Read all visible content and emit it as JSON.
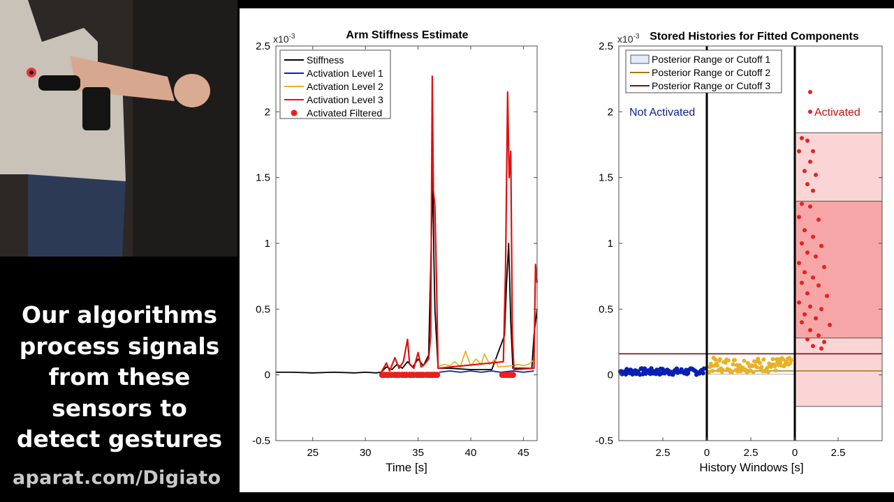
{
  "caption": "Our algorithms\nprocess signals\nfrom  these\nsensors to\ndetect gestures",
  "watermark": "aparat.com/Digiato",
  "photo": {
    "description_icon": "person-with-armband-sensors-photo"
  },
  "colors": {
    "stiffness": "#000000",
    "level1": "#0a1fb5",
    "level2": "#e8b227",
    "level3": "#e01010",
    "activated_points": "#ea1f1f",
    "not_activated_text": "#0a1f8f",
    "activated_text": "#c01010",
    "cutoff2": "#9b7a12",
    "cutoff3": "#7a0d0d"
  },
  "chart_data": [
    {
      "type": "line",
      "title": "Arm Stiffness Estimate",
      "xlabel": "Time [s]",
      "ylabel": "",
      "exponent_label": "x10-3",
      "xlim": [
        21.5,
        46.3
      ],
      "ylim": [
        -0.5,
        2.5
      ],
      "xticks": [
        25,
        30,
        35,
        40,
        45
      ],
      "yticks": [
        -0.5,
        0,
        0.5,
        1,
        1.5,
        2,
        2.5
      ],
      "ytick_labels": [
        "-0.5",
        "0",
        "0.5",
        "1",
        "1.5",
        "2",
        "2.5"
      ],
      "grid": false,
      "legend_position": "top-left",
      "legend": [
        "Stiffness",
        "Activation Level 1",
        "Activation Level 2",
        "Activation Level 3",
        "Activated Filtered"
      ],
      "series": [
        {
          "name": "Stiffness",
          "color": "#000000",
          "points": [
            [
              21.5,
              0.02
            ],
            [
              23,
              0.02
            ],
            [
              25,
              0.015
            ],
            [
              27,
              0.02
            ],
            [
              29,
              0.015
            ],
            [
              30,
              0.02
            ],
            [
              31,
              0.015
            ],
            [
              31.5,
              0.02
            ],
            [
              32,
              0.06
            ],
            [
              32.5,
              0.04
            ],
            [
              33,
              0.08
            ],
            [
              33.5,
              0.05
            ],
            [
              34,
              0.1
            ],
            [
              34.5,
              0.06
            ],
            [
              35,
              0.12
            ],
            [
              35.5,
              0.07
            ],
            [
              36,
              0.15
            ],
            [
              36.4,
              1.5
            ],
            [
              36.5,
              0.9
            ],
            [
              36.6,
              0.5
            ],
            [
              36.9,
              0.05
            ],
            [
              38,
              0.05
            ],
            [
              40,
              0.04
            ],
            [
              42,
              0.04
            ],
            [
              43.2,
              0.3
            ],
            [
              43.4,
              0.7
            ],
            [
              43.6,
              1.0
            ],
            [
              43.8,
              0.4
            ],
            [
              44,
              0.05
            ],
            [
              45,
              0.05
            ],
            [
              45.8,
              0.05
            ],
            [
              46,
              0.3
            ],
            [
              46.3,
              0.5
            ]
          ]
        },
        {
          "name": "Activation Level 1",
          "color": "#0a1fb5",
          "points": [
            [
              37,
              0.02
            ],
            [
              38,
              0.03
            ],
            [
              39,
              0.02
            ],
            [
              40,
              0.03
            ],
            [
              41,
              0.02
            ],
            [
              42,
              0.03
            ],
            [
              42.8,
              0.02
            ],
            [
              44,
              0.03
            ],
            [
              45,
              0.02
            ],
            [
              46,
              0.03
            ]
          ]
        },
        {
          "name": "Activation Level 2",
          "color": "#e8b227",
          "points": [
            [
              36.8,
              0.06
            ],
            [
              37.5,
              0.08
            ],
            [
              38,
              0.07
            ],
            [
              38.5,
              0.1
            ],
            [
              39,
              0.06
            ],
            [
              39.5,
              0.18
            ],
            [
              40,
              0.07
            ],
            [
              40.5,
              0.12
            ],
            [
              41,
              0.08
            ],
            [
              41.3,
              0.16
            ],
            [
              41.8,
              0.08
            ],
            [
              42.3,
              0.12
            ],
            [
              42.6,
              0.06
            ],
            [
              44,
              0.07
            ],
            [
              44.5,
              0.08
            ],
            [
              45,
              0.07
            ],
            [
              45.5,
              0.08
            ],
            [
              46.1,
              0.12
            ]
          ]
        },
        {
          "name": "Activation Level 3",
          "color": "#e01010",
          "points": [
            [
              31.5,
              0.02
            ],
            [
              32,
              0.09
            ],
            [
              32.3,
              0.03
            ],
            [
              32.8,
              0.13
            ],
            [
              33.2,
              0.05
            ],
            [
              33.6,
              0.1
            ],
            [
              34,
              0.27
            ],
            [
              34.2,
              0.08
            ],
            [
              34.6,
              0.05
            ],
            [
              35,
              0.17
            ],
            [
              35.3,
              0.06
            ],
            [
              35.6,
              0.08
            ],
            [
              36,
              0.12
            ],
            [
              36.2,
              0.3
            ],
            [
              36.35,
              2.27
            ],
            [
              36.45,
              1.4
            ],
            [
              36.6,
              1.28
            ],
            [
              36.75,
              0.7
            ],
            [
              36.9,
              0.05
            ],
            [
              43.1,
              0.1
            ],
            [
              43.3,
              0.8
            ],
            [
              43.5,
              2.15
            ],
            [
              43.65,
              1.5
            ],
            [
              43.8,
              1.7
            ],
            [
              43.95,
              0.3
            ],
            [
              44.1,
              0.04
            ],
            [
              46,
              0.05
            ],
            [
              46.15,
              0.84
            ],
            [
              46.3,
              0.7
            ]
          ]
        }
      ],
      "activated_filtered_x": [
        31.6,
        31.8,
        32.0,
        32.2,
        32.5,
        32.8,
        33.0,
        33.2,
        33.5,
        33.7,
        33.9,
        34.2,
        34.4,
        34.6,
        34.9,
        35.1,
        35.3,
        35.5,
        35.8,
        36.0,
        36.2,
        36.4,
        36.6,
        36.8,
        43.0,
        43.2,
        43.4,
        43.6,
        43.8,
        44.0
      ],
      "activated_filtered_y": 0
    },
    {
      "type": "scatter",
      "title": "Stored Histories for Fitted Components",
      "xlabel": "History Windows [s]",
      "exponent_label": "x10-3",
      "ylim": [
        -0.5,
        2.5
      ],
      "yticks": [
        -0.5,
        0,
        0.5,
        1,
        1.5,
        2,
        2.5
      ],
      "ytick_labels": [
        "-0.5",
        "0",
        "0.5",
        "1",
        "1.5",
        "2",
        "2.5"
      ],
      "xtick_labels": [
        "2.5",
        "0",
        "2.5",
        "0",
        "2.5"
      ],
      "grid": false,
      "legend_position": "top-left",
      "legend": [
        "Posterior Range or Cutoff 1",
        "Posterior Range or Cutoff 2",
        "Posterior Range or Cutoff 3"
      ],
      "annotations": [
        "Not Activated",
        "Activated"
      ],
      "cutoff_lines": [
        {
          "name": "Posterior Range or Cutoff 3",
          "y": 0.16
        },
        {
          "name": "Posterior Range or Cutoff 2",
          "y": 0.03
        }
      ],
      "bands": [
        {
          "y0": -0.24,
          "y1": 1.84,
          "shade": "light"
        },
        {
          "y0": 0.28,
          "y1": 1.32,
          "shade": "medium"
        }
      ],
      "groups": [
        {
          "name": "Not Activated",
          "color": "#0a1fb5",
          "y_range": [
            0.0,
            0.05
          ]
        },
        {
          "name": "Level 2",
          "color": "#e8b227",
          "y_range": [
            0.02,
            0.13
          ]
        },
        {
          "name": "Activated",
          "color": "#ea1f1f",
          "points": [
            [
              0.2,
              1.8
            ],
            [
              0.4,
              1.78
            ],
            [
              0.1,
              1.7
            ],
            [
              0.6,
              1.7
            ],
            [
              0.5,
              1.62
            ],
            [
              0.3,
              1.55
            ],
            [
              0.7,
              1.52
            ],
            [
              0.4,
              1.45
            ],
            [
              0.6,
              1.4
            ],
            [
              0.2,
              1.3
            ],
            [
              0.5,
              1.28
            ],
            [
              0.1,
              1.2
            ],
            [
              0.8,
              1.18
            ],
            [
              0.3,
              1.1
            ],
            [
              0.6,
              1.05
            ],
            [
              0.2,
              1.0
            ],
            [
              0.9,
              0.98
            ],
            [
              0.4,
              0.93
            ],
            [
              0.7,
              0.9
            ],
            [
              0.1,
              0.85
            ],
            [
              1.0,
              0.82
            ],
            [
              0.3,
              0.78
            ],
            [
              0.6,
              0.74
            ],
            [
              0.2,
              0.7
            ],
            [
              0.8,
              0.68
            ],
            [
              0.4,
              0.62
            ],
            [
              1.1,
              0.6
            ],
            [
              0.1,
              0.55
            ],
            [
              0.5,
              0.52
            ],
            [
              0.9,
              0.5
            ],
            [
              0.3,
              0.46
            ],
            [
              0.7,
              0.43
            ],
            [
              0.2,
              0.4
            ],
            [
              1.2,
              0.38
            ],
            [
              0.5,
              0.34
            ],
            [
              0.8,
              0.3
            ],
            [
              0.4,
              0.27
            ],
            [
              1.0,
              0.25
            ],
            [
              0.6,
              0.22
            ],
            [
              0.9,
              0.2
            ],
            [
              0.5,
              2.15
            ],
            [
              0.5,
              2.0
            ]
          ]
        }
      ]
    }
  ]
}
